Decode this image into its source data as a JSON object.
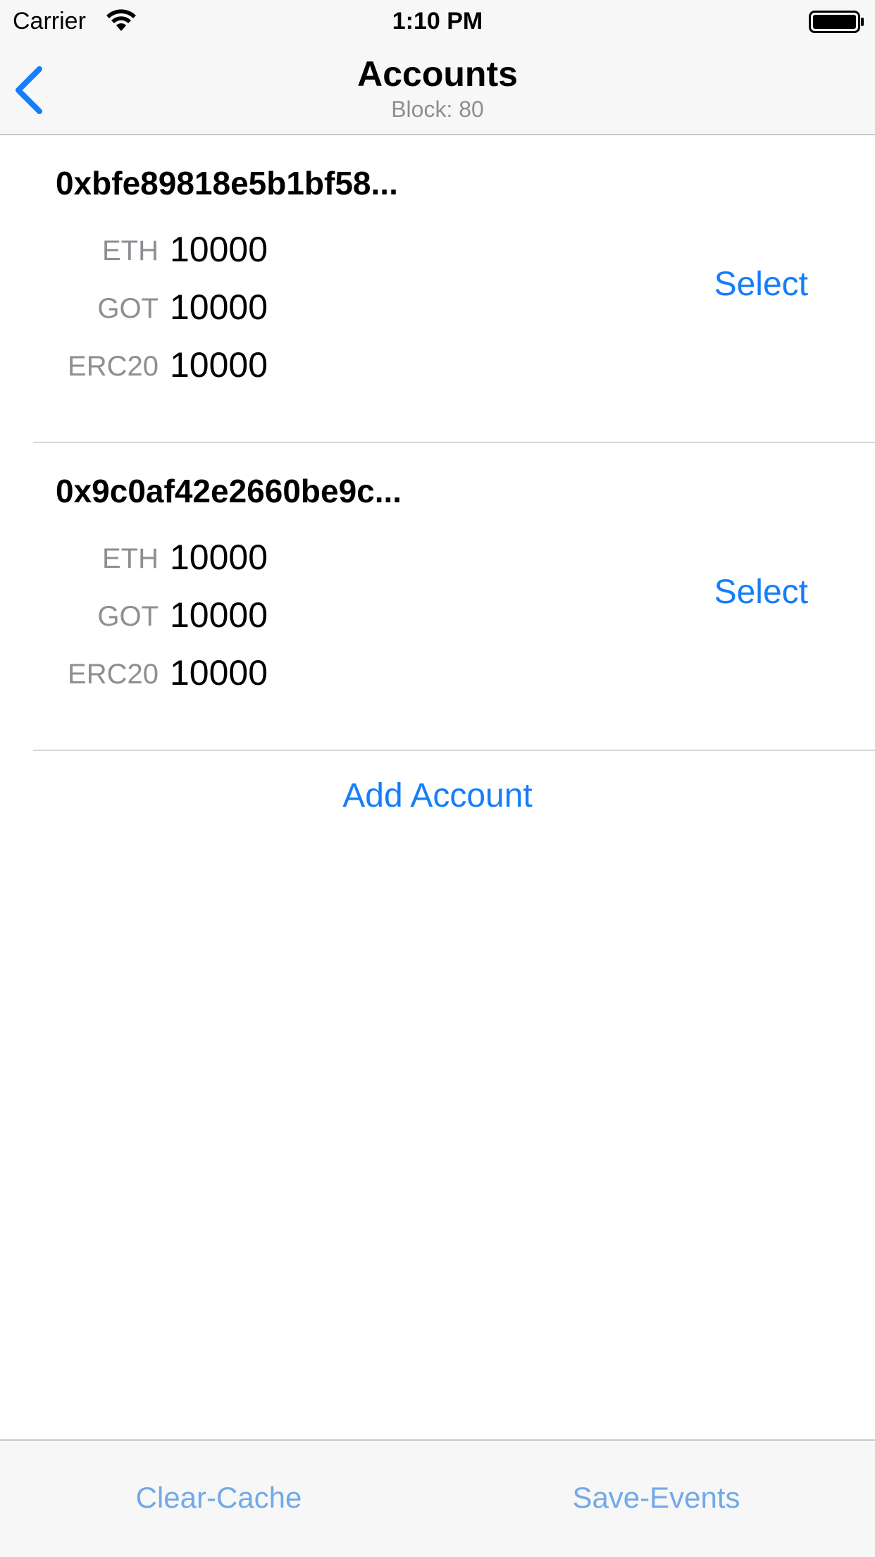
{
  "status_bar": {
    "carrier": "Carrier",
    "time": "1:10 PM",
    "wifi_icon": "wifi-icon",
    "battery_icon": "battery-icon"
  },
  "nav": {
    "title": "Accounts",
    "subtitle": "Block: 80",
    "back_icon": "chevron-left-icon"
  },
  "accounts": [
    {
      "address": "0xbfe89818e5b1bf58...",
      "balances": [
        {
          "token": "ETH",
          "value": "10000"
        },
        {
          "token": "GOT",
          "value": "10000"
        },
        {
          "token": "ERC20",
          "value": "10000"
        }
      ],
      "action_label": "Select"
    },
    {
      "address": "0x9c0af42e2660be9c...",
      "balances": [
        {
          "token": "ETH",
          "value": "10000"
        },
        {
          "token": "GOT",
          "value": "10000"
        },
        {
          "token": "ERC20",
          "value": "10000"
        }
      ],
      "action_label": "Select"
    }
  ],
  "add_account_label": "Add Account",
  "toolbar": {
    "clear_cache_label": "Clear-Cache",
    "save_events_label": "Save-Events"
  },
  "colors": {
    "accent": "#157efb",
    "toolbar_text": "#72a9e8",
    "secondary_text": "#8e8e93",
    "bar_background": "#f7f7f7"
  }
}
